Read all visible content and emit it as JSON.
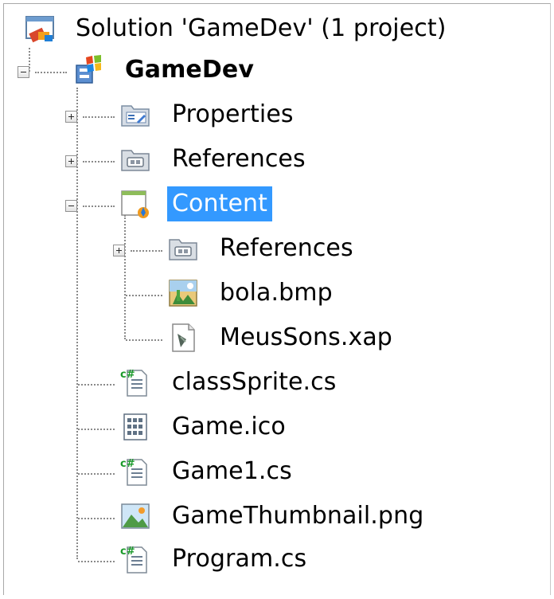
{
  "solution_explorer": {
    "root": {
      "label": "Solution 'GameDev' (1 project)",
      "icon": "solution-icon"
    },
    "project": {
      "label": "GameDev",
      "icon": "project-icon",
      "expanded": true
    },
    "items": [
      {
        "label": "Properties",
        "icon": "properties-icon",
        "expanded": false
      },
      {
        "label": "References",
        "icon": "references-icon",
        "expanded": false
      },
      {
        "label": "Content",
        "icon": "content-icon",
        "expanded": true,
        "selected": true
      },
      {
        "label": "References",
        "icon": "references-icon",
        "expanded": false
      },
      {
        "label": "bola.bmp",
        "icon": "bitmap-icon"
      },
      {
        "label": "MeusSons.xap",
        "icon": "xap-audio-icon"
      },
      {
        "label": "classSprite.cs",
        "icon": "csharp-file-icon"
      },
      {
        "label": "Game.ico",
        "icon": "ico-file-icon"
      },
      {
        "label": "Game1.cs",
        "icon": "csharp-file-icon"
      },
      {
        "label": "GameThumbnail.png",
        "icon": "png-image-icon"
      },
      {
        "label": "Program.cs",
        "icon": "csharp-file-icon"
      }
    ]
  },
  "colors": {
    "selection_background": "#3399ff",
    "selection_text": "#ffffff",
    "tree_lines": "#8a8a8a",
    "text": "#000000"
  }
}
